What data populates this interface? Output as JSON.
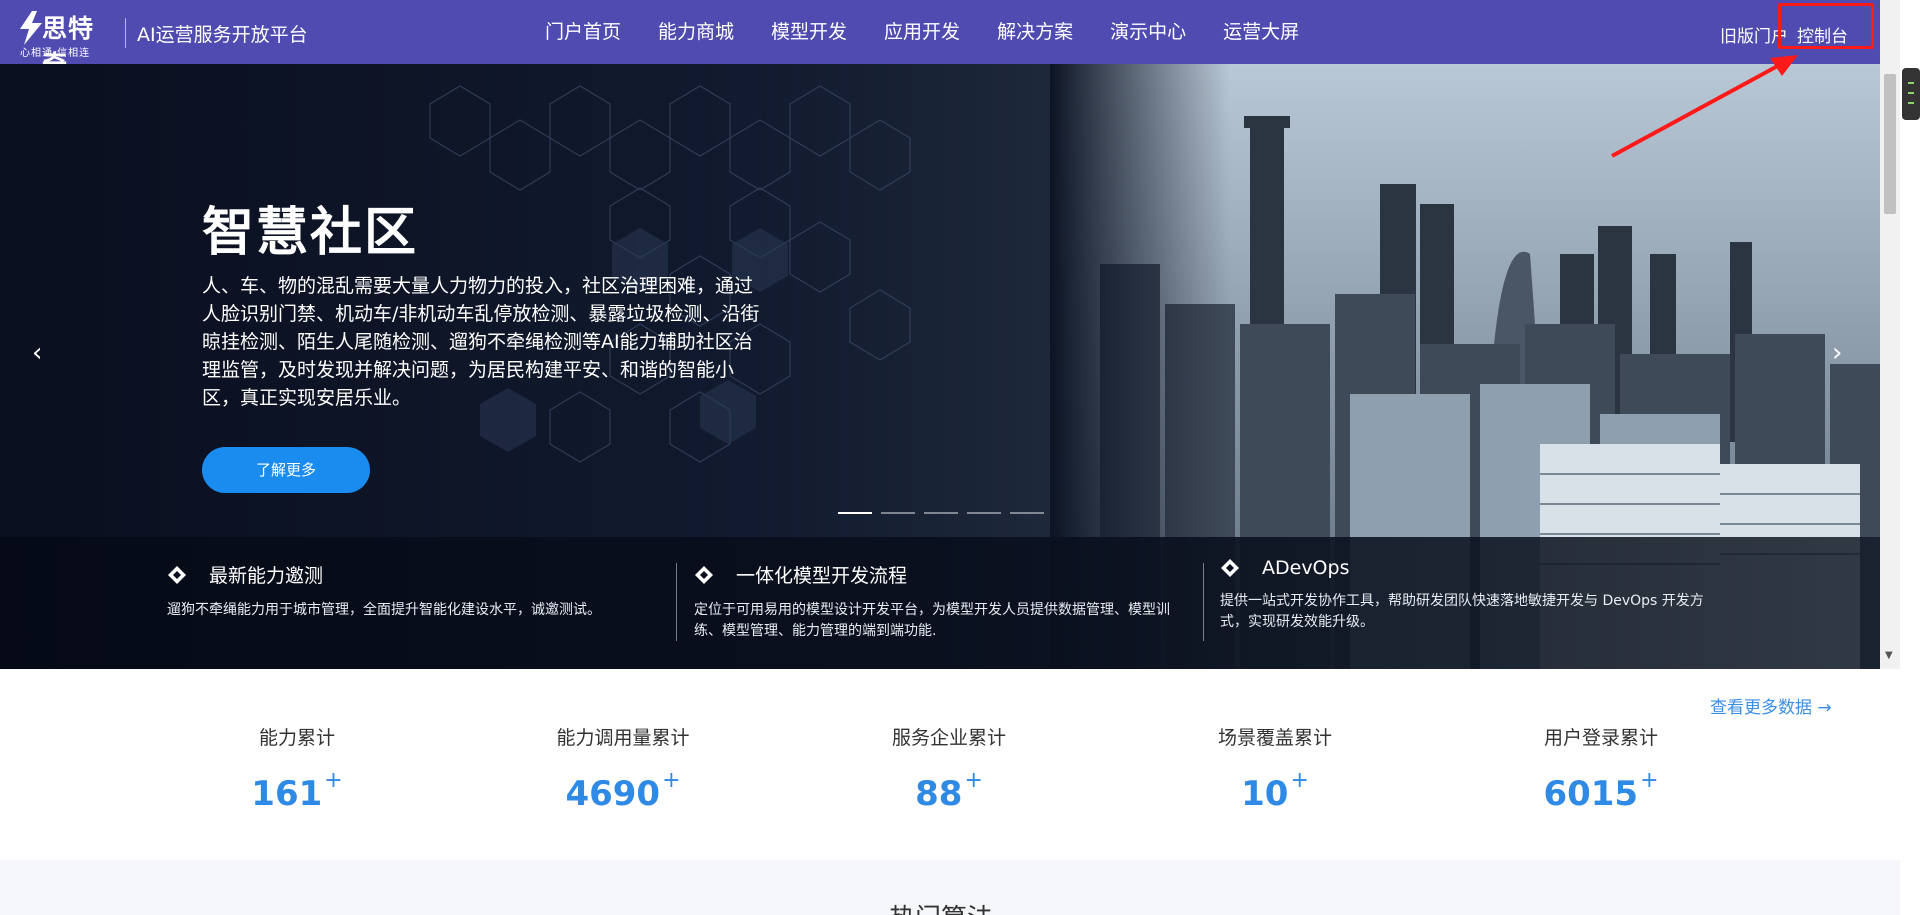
{
  "header": {
    "logo": {
      "name": "思特奇",
      "slogan": "心相通·信相连"
    },
    "platform_name": "AI运营服务开放平台",
    "nav": [
      "门户首页",
      "能力商城",
      "模型开发",
      "应用开发",
      "解决方案",
      "演示中心",
      "运营大屏"
    ],
    "old_portal": "旧版门户",
    "console": "控制台",
    "colors": {
      "bar": "#4f4bb1",
      "highlight": "#ff1a1a"
    }
  },
  "hero": {
    "title": "智慧社区",
    "description": "人、车、物的混乱需要大量人力物力的投入，社区治理困难，通过人脸识别门禁、机动车/非机动车乱停放检测、暴露垃圾检测、沿街晾挂检测、陌生人尾随检测、遛狗不牵绳检测等AI能力辅助社区治理监管，及时发现并解决问题，为居民构建平安、和谐的智能小区，真正实现安居乐业。",
    "button": "了解更多",
    "prev_icon": "‹",
    "next_icon": "›",
    "slides_total": 5,
    "active_slide": 1
  },
  "features": [
    {
      "icon": "diamond-icon",
      "title": "最新能力邀测",
      "desc": "遛狗不牵绳能力用于城市管理，全面提升智能化建设水平，诚邀测试。"
    },
    {
      "icon": "diamond-icon",
      "title": "一体化模型开发流程",
      "desc": "定位于可用易用的模型设计开发平台，为模型开发人员提供数据管理、模型训练、模型管理、能力管理的端到端功能."
    },
    {
      "icon": "diamond-icon",
      "title": "ADevOps",
      "desc": "提供一站式开发协作工具，帮助研发团队快速落地敏捷开发与 DevOps 开发方式，实现研发效能升级。"
    }
  ],
  "stats": {
    "more_link": "查看更多数据 →",
    "items": [
      {
        "label": "能力累计",
        "value": "161",
        "plus": "+"
      },
      {
        "label": "能力调用量累计",
        "value": "4690",
        "plus": "+"
      },
      {
        "label": "服务企业累计",
        "value": "88",
        "plus": "+"
      },
      {
        "label": "场景覆盖累计",
        "value": "10",
        "plus": "+"
      },
      {
        "label": "用户登录累计",
        "value": "6015",
        "plus": "+"
      }
    ]
  },
  "hot_section": {
    "title": "热门算法"
  }
}
